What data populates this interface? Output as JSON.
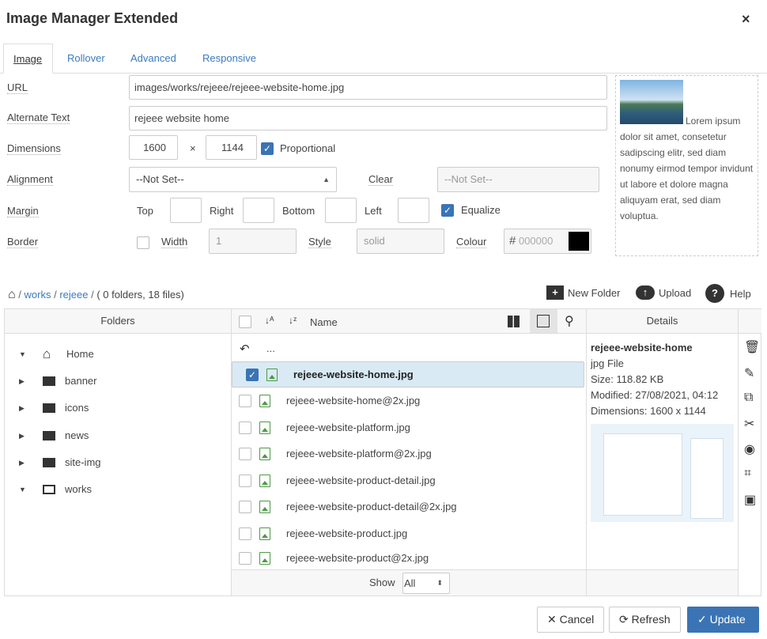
{
  "dialog": {
    "title": "Image Manager Extended",
    "close": "×"
  },
  "tabs": [
    {
      "label": "Image"
    },
    {
      "label": "Rollover"
    },
    {
      "label": "Advanced"
    },
    {
      "label": "Responsive"
    }
  ],
  "form": {
    "url": {
      "label": "URL",
      "value": "images/works/rejeee/rejeee-website-home.jpg"
    },
    "alt": {
      "label": "Alternate Text",
      "value": "rejeee website home"
    },
    "dimensions": {
      "label": "Dimensions",
      "width": "1600",
      "height": "1144",
      "sep": "×",
      "proportional": "Proportional",
      "proportional_checked": true
    },
    "alignment": {
      "label": "Alignment",
      "value": "--Not Set--",
      "clear_label": "Clear",
      "clear_value": "--Not Set--"
    },
    "margin": {
      "label": "Margin",
      "top": "Top",
      "right": "Right",
      "bottom": "Bottom",
      "left": "Left",
      "equalize": "Equalize",
      "equalize_checked": true
    },
    "border": {
      "label": "Border",
      "checked": false,
      "width_label": "Width",
      "width": "1",
      "style_label": "Style",
      "style": "solid",
      "colour_label": "Colour",
      "colour_placeholder": "000000",
      "colour": "#000000"
    }
  },
  "preview": {
    "text": "Lorem ipsum dolor sit amet, consetetur sadipscing elitr, sed diam nonumy eirmod tempor invidunt ut labore et dolore magna aliquyam erat, sed diam voluptua."
  },
  "breadcrumb": {
    "items": [
      "works",
      "rejeee"
    ],
    "summary": "( 0 folders, 18 files)"
  },
  "toolbar": {
    "new_folder": "New Folder",
    "upload": "Upload",
    "help": "Help"
  },
  "folders": {
    "header": "Folders",
    "items": [
      {
        "label": "Home",
        "expanded": true
      },
      {
        "label": "banner"
      },
      {
        "label": "icons"
      },
      {
        "label": "news"
      },
      {
        "label": "site-img"
      },
      {
        "label": "works",
        "expanded": true
      }
    ]
  },
  "files": {
    "header": "Name",
    "up": "...",
    "items": [
      {
        "name": "rejeee-website-home.jpg",
        "selected": true
      },
      {
        "name": "rejeee-website-home@2x.jpg"
      },
      {
        "name": "rejeee-website-platform.jpg"
      },
      {
        "name": "rejeee-website-platform@2x.jpg"
      },
      {
        "name": "rejeee-website-product-detail.jpg"
      },
      {
        "name": "rejeee-website-product-detail@2x.jpg"
      },
      {
        "name": "rejeee-website-product.jpg"
      },
      {
        "name": "rejeee-website-product@2x.jpg"
      }
    ],
    "show_label": "Show",
    "show_value": "All"
  },
  "details": {
    "header": "Details",
    "name": "rejeee-website-home",
    "type": "jpg File",
    "size": "Size: 118.82 KB",
    "modified": "Modified: 27/08/2021, 04:12",
    "dimensions": "Dimensions: 1600 x 1144"
  },
  "buttons": {
    "cancel": "Cancel",
    "refresh": "Refresh",
    "update": "Update"
  },
  "colors": {
    "accent": "#3a74b5",
    "link": "#3a7bbf",
    "selected_row": "#d9eaf4"
  }
}
